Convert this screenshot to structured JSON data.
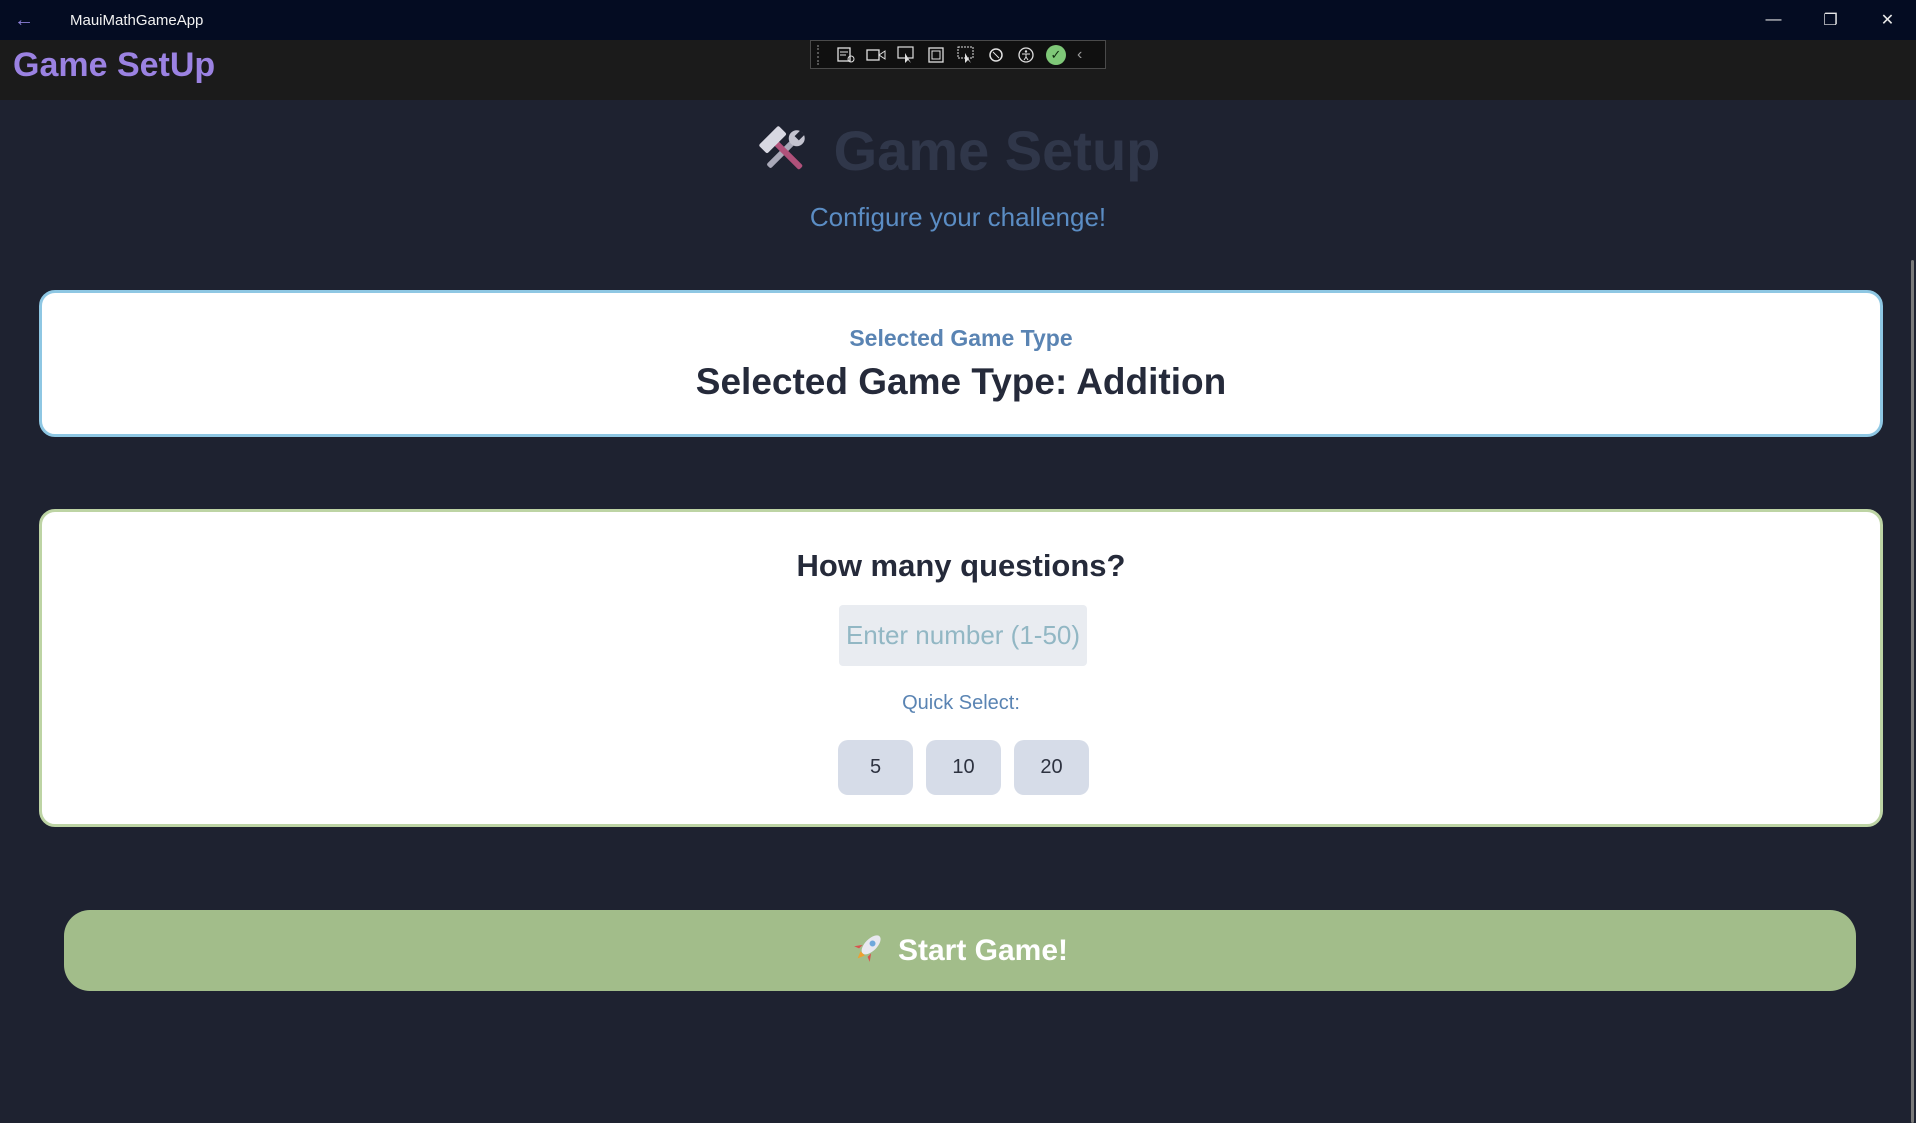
{
  "window": {
    "back_icon": "←",
    "title": "MauiMathGameApp",
    "controls": {
      "minimize": "—",
      "maximize": "❐",
      "close": "✕"
    }
  },
  "navbar": {
    "title": "Game SetUp"
  },
  "devtools": {
    "icons": [
      "live-visual-tree-icon",
      "video-capture-icon",
      "select-element-icon",
      "display-layout-adorners-icon",
      "track-focused-element-icon",
      "hot-reload-icon",
      "accessibility-icon",
      "check-icon",
      "collapse-chevron-icon"
    ]
  },
  "header": {
    "icon": "hammer-and-wrench-icon",
    "title": "Game Setup",
    "subtitle": "Configure your challenge!"
  },
  "game_type_card": {
    "label": "Selected Game Type",
    "value": "Selected Game Type: Addition"
  },
  "questions_card": {
    "title": "How many questions?",
    "input_placeholder": "Enter number (1-50)",
    "input_value": "",
    "quick_select_label": "Quick Select:",
    "quick_options": [
      "5",
      "10",
      "20"
    ]
  },
  "start_button": {
    "icon": "rocket-icon",
    "label": "Start Game!"
  },
  "colors": {
    "accent_purple": "#9b82e2",
    "card_border_blue": "#8ec7e3",
    "card_border_green": "#bdd4a4",
    "start_button": "#a2bd8a",
    "subtitle_blue": "#5b8dc4"
  }
}
